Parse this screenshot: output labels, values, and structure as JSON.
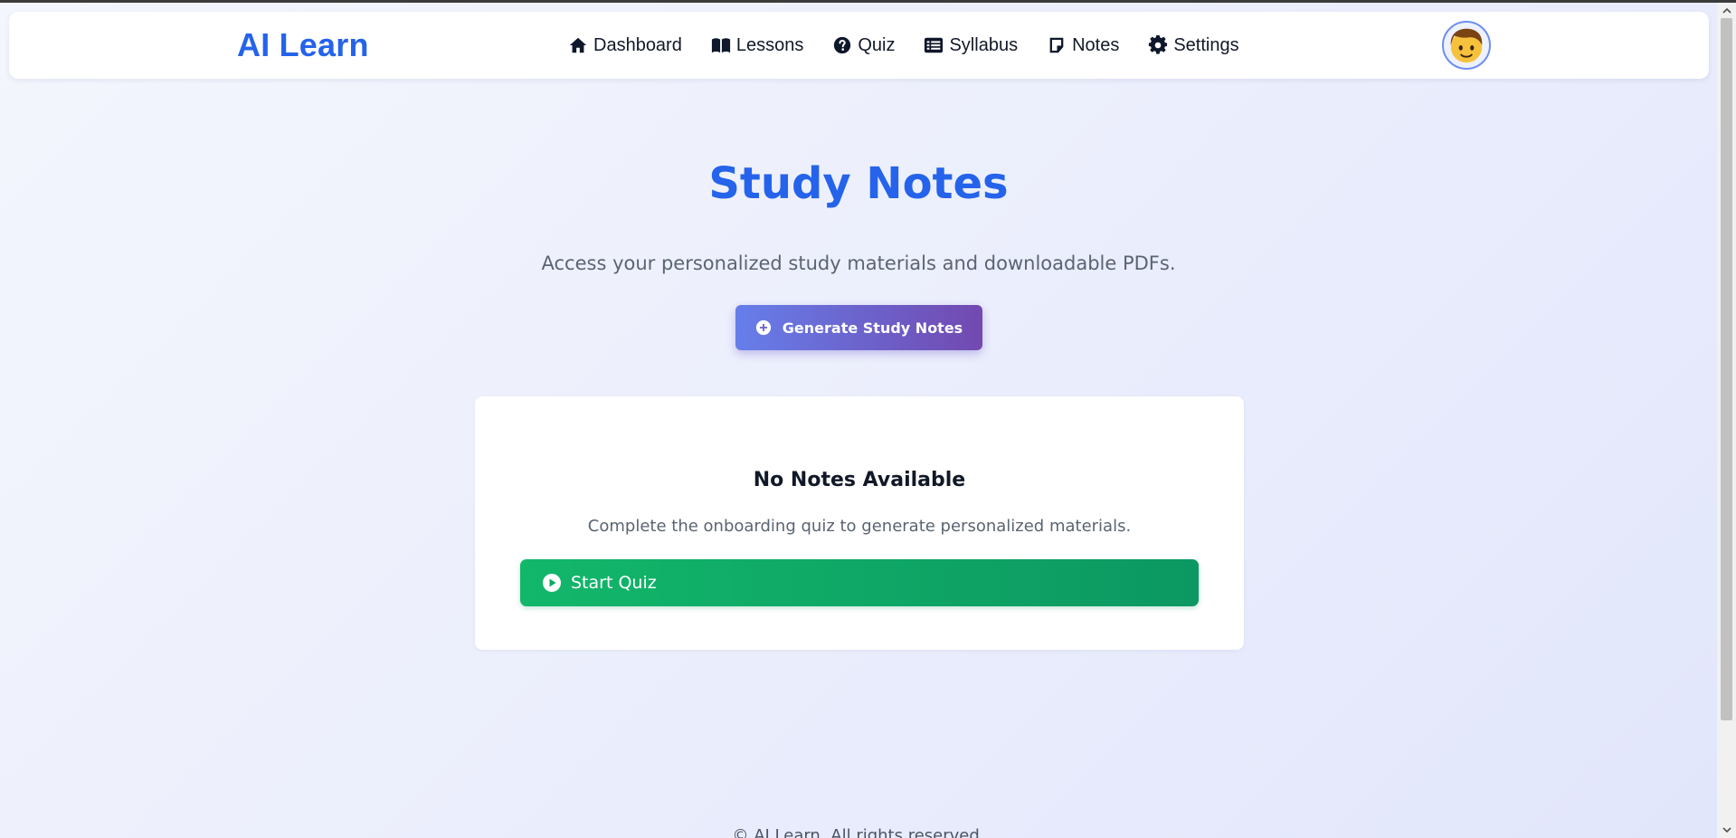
{
  "header": {
    "brand": "AI Learn",
    "nav": [
      {
        "label": "Dashboard",
        "icon": "home-icon"
      },
      {
        "label": "Lessons",
        "icon": "book-icon"
      },
      {
        "label": "Quiz",
        "icon": "question-circle-icon"
      },
      {
        "label": "Syllabus",
        "icon": "list-icon"
      },
      {
        "label": "Notes",
        "icon": "sticky-note-icon"
      },
      {
        "label": "Settings",
        "icon": "gear-icon"
      }
    ],
    "avatar_icon": "boy-face-icon"
  },
  "main": {
    "title": "Study Notes",
    "subtitle": "Access your personalized study materials and downloadable PDFs.",
    "generate_button": {
      "label": "Generate Study Notes",
      "icon": "plus-circle-icon"
    },
    "empty_state": {
      "title": "No Notes Available",
      "text": "Complete the onboarding quiz to generate personalized materials.",
      "button": {
        "label": "Start Quiz",
        "icon": "play-circle-icon"
      }
    }
  },
  "footer": {
    "text": "© AI Learn. All rights reserved."
  },
  "colors": {
    "brand": "#2563eb",
    "generate_gradient_start": "#667eea",
    "generate_gradient_end": "#7249b0",
    "quiz_button": "#12b76a",
    "text_muted": "#5b6472"
  }
}
